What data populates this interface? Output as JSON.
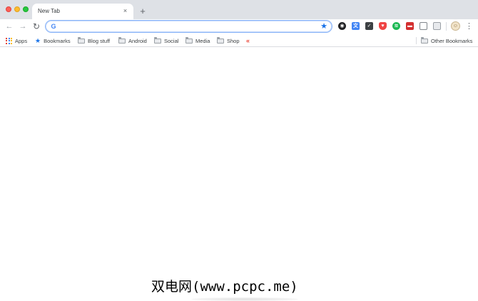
{
  "window": {
    "traffic_lights": {
      "close": "#fe5f57",
      "minimize": "#febc2e",
      "zoom": "#28c840"
    }
  },
  "tabs": [
    {
      "title": "New Tab",
      "close_glyph": "×",
      "active": true
    }
  ],
  "new_tab_glyph": "+",
  "toolbar": {
    "back_icon": "←",
    "forward_icon": "→",
    "reload_icon": "↻",
    "omnibox": {
      "value": "",
      "placeholder": "",
      "search_icon": "G",
      "star_icon": "★"
    },
    "extensions": [
      {
        "name": "extension-1-icon",
        "glyph": "◉"
      },
      {
        "name": "extension-2-icon",
        "glyph": "文"
      },
      {
        "name": "pocket-icon",
        "glyph": "✓"
      },
      {
        "name": "shield-icon",
        "glyph": "♥"
      },
      {
        "name": "spotify-icon",
        "glyph": "≋"
      },
      {
        "name": "extension-6-icon",
        "glyph": "▬"
      },
      {
        "name": "extension-7-icon",
        "glyph": ""
      },
      {
        "name": "extension-8-icon",
        "glyph": ""
      }
    ],
    "avatar_glyph": "☺",
    "menu_icon": "⋮"
  },
  "bookmarks_bar": {
    "items": [
      {
        "label": "Apps",
        "icon": "apps-grid-icon"
      },
      {
        "label": "Bookmarks",
        "icon": "star-icon"
      },
      {
        "label": "Blog stuff",
        "icon": "folder-icon"
      },
      {
        "label": "Android",
        "icon": "folder-icon"
      },
      {
        "label": "Social",
        "icon": "folder-icon"
      },
      {
        "label": "Media",
        "icon": "folder-icon"
      },
      {
        "label": "Shop",
        "icon": "folder-icon"
      },
      {
        "label": "",
        "icon": "chevron-icon",
        "glyph": "«"
      }
    ],
    "other": {
      "label": "Other Bookmarks",
      "icon": "folder-icon"
    }
  },
  "watermark": {
    "text": "双电网(www.pcpc.me)"
  },
  "colors": {
    "tabstrip": "#dee1e6",
    "accent": "#1a73e8",
    "omnibox_border": "#8ab4f8"
  }
}
